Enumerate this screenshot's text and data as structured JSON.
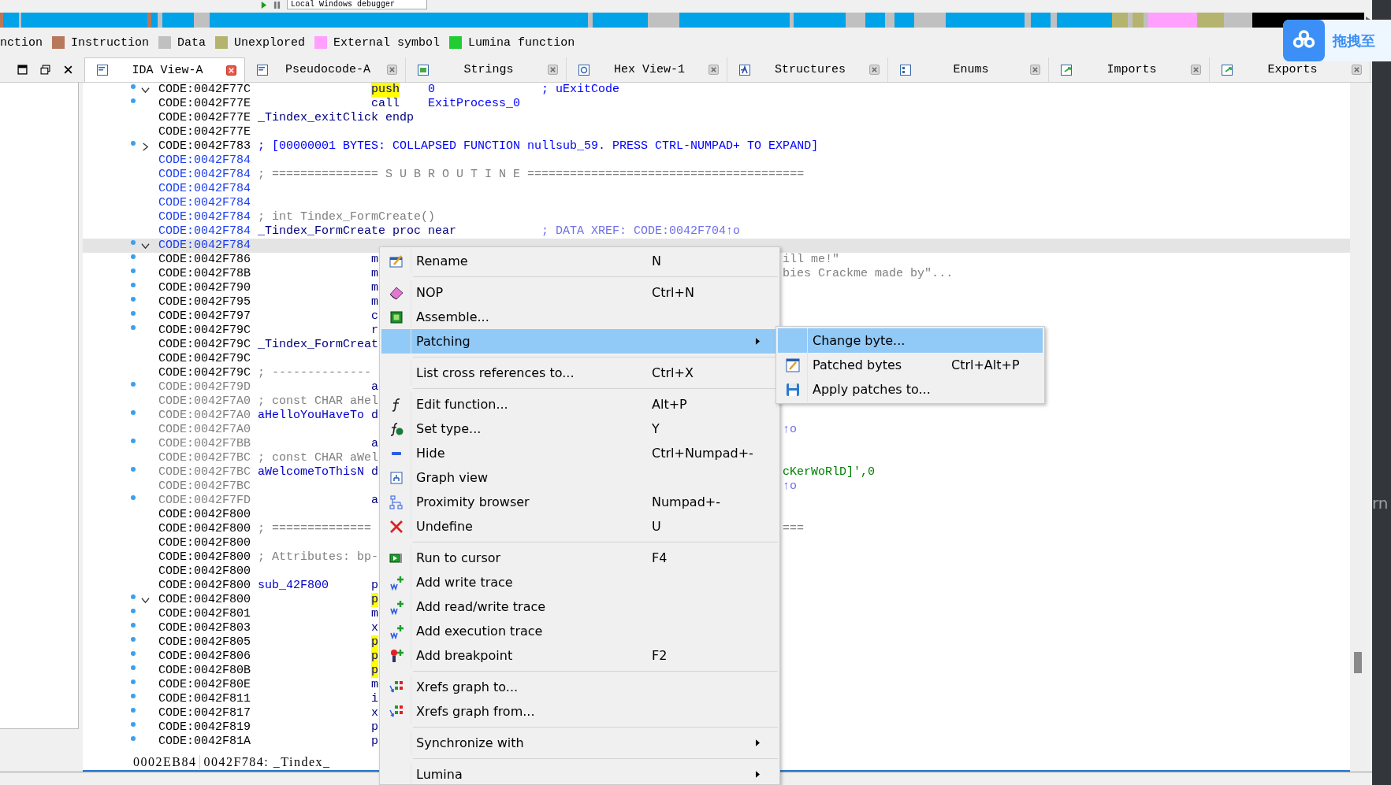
{
  "toolbar": {
    "debugger": "Local Windows debugger"
  },
  "legend": [
    {
      "label": "nction"
    },
    {
      "label": "Instruction",
      "color": "#b8785a"
    },
    {
      "label": "Data",
      "color": "#c0c0c0"
    },
    {
      "label": "Unexplored",
      "color": "#b4b46e"
    },
    {
      "label": "External symbol",
      "color": "#ffa0ff"
    },
    {
      "label": "Lumina function",
      "color": "#22cc33"
    }
  ],
  "tabs": [
    {
      "label": "IDA View-A",
      "selected": true
    },
    {
      "label": "Pseudocode-A",
      "selected": false
    },
    {
      "label": "Strings",
      "selected": false
    },
    {
      "label": "Hex View-1",
      "selected": false
    },
    {
      "label": "Structures",
      "selected": false
    },
    {
      "label": "Enums",
      "selected": false
    },
    {
      "label": "Imports",
      "selected": false
    },
    {
      "label": "Exports",
      "selected": false
    }
  ],
  "rows": [
    {
      "marker": true,
      "expanded": true,
      "address": "CODE:0042F77C",
      "kind": "code",
      "mnemonic": {
        "text": "push",
        "highlighted": true
      },
      "operand": "0",
      "comment": {
        "text": "; uExitCode",
        "kind": "note"
      },
      "selected": false
    },
    {
      "marker": true,
      "address": "CODE:0042F77E",
      "kind": "code",
      "mnemonic": {
        "text": "call",
        "highlighted": false
      },
      "operand": "ExitProcess_0",
      "selected": false
    },
    {
      "marker": false,
      "address": "CODE:0042F77E",
      "kind": "code",
      "label": {
        "text": "_Tindex_exitClick endp",
        "kind": "name"
      },
      "selected": false
    },
    {
      "marker": false,
      "address": "CODE:0042F77E",
      "kind": "code",
      "selected": false
    },
    {
      "marker": true,
      "expanded": false,
      "address": "CODE:0042F783",
      "kind": "code",
      "label": {
        "text": "; [00000001 BYTES: COLLAPSED FUNCTION nullsub_59. PRESS CTRL-NUMPAD+ TO EXPAND]",
        "kind": "collapsed"
      },
      "selected": false
    },
    {
      "marker": false,
      "address": "CODE:0042F784",
      "kind": "func",
      "selected": false
    },
    {
      "marker": false,
      "address": "CODE:0042F784",
      "kind": "func",
      "label": {
        "text": "; =============== S U B R O U T I N E =======================================",
        "kind": "comment"
      },
      "selected": false
    },
    {
      "marker": false,
      "address": "CODE:0042F784",
      "kind": "func",
      "selected": false
    },
    {
      "marker": false,
      "address": "CODE:0042F784",
      "kind": "func",
      "selected": false
    },
    {
      "marker": false,
      "address": "CODE:0042F784",
      "kind": "func",
      "label": {
        "text": "; int Tindex_FormCreate()",
        "kind": "comment"
      },
      "selected": false
    },
    {
      "marker": false,
      "address": "CODE:0042F784",
      "kind": "func",
      "label": {
        "text": "_Tindex_FormCreate proc near",
        "kind": "name"
      },
      "comment": {
        "text": "; DATA XREF: CODE:0042F704↑o",
        "kind": "xref"
      },
      "selected": false
    },
    {
      "marker": true,
      "expanded": true,
      "address": "CODE:0042F784",
      "kind": "func",
      "selected": true
    },
    {
      "marker": true,
      "address": "CODE:0042F786",
      "kind": "code",
      "mnemonic": {
        "text": "m",
        "highlighted": false
      },
      "tail": {
        "text": "ill me!\"",
        "kind": "comment"
      },
      "selected": false
    },
    {
      "marker": true,
      "address": "CODE:0042F78B",
      "kind": "code",
      "mnemonic": {
        "text": "m",
        "highlighted": false
      },
      "tail": {
        "text": "bies Crackme made by\"...",
        "kind": "comment"
      },
      "selected": false
    },
    {
      "marker": true,
      "address": "CODE:0042F790",
      "kind": "code",
      "mnemonic": {
        "text": "m",
        "highlighted": false
      },
      "selected": false
    },
    {
      "marker": true,
      "address": "CODE:0042F795",
      "kind": "code",
      "mnemonic": {
        "text": "m",
        "highlighted": false
      },
      "selected": false
    },
    {
      "marker": true,
      "address": "CODE:0042F797",
      "kind": "code",
      "mnemonic": {
        "text": "c",
        "highlighted": false
      },
      "selected": false
    },
    {
      "marker": true,
      "address": "CODE:0042F79C",
      "kind": "code",
      "mnemonic": {
        "text": "r",
        "highlighted": false
      },
      "selected": false
    },
    {
      "marker": false,
      "address": "CODE:0042F79C",
      "kind": "code",
      "label": {
        "text": "_Tindex_FormCreat",
        "kind": "name"
      },
      "selected": false
    },
    {
      "marker": false,
      "address": "CODE:0042F79C",
      "kind": "code",
      "selected": false
    },
    {
      "marker": false,
      "address": "CODE:0042F79C",
      "kind": "code",
      "label": {
        "text": "; --------------",
        "kind": "comment"
      },
      "selected": false
    },
    {
      "marker": true,
      "address": "CODE:0042F79D",
      "kind": "data",
      "mnemonic": {
        "text": "a",
        "highlighted": false
      },
      "selected": false
    },
    {
      "marker": false,
      "address": "CODE:0042F7A0",
      "kind": "data",
      "label": {
        "text": "; const CHAR aHel",
        "kind": "comment"
      },
      "selected": false
    },
    {
      "marker": true,
      "address": "CODE:0042F7A0",
      "kind": "data",
      "label": {
        "text": "aHelloYouHaveTo",
        "kind": "data"
      },
      "mnemonic": {
        "text": "d",
        "highlighted": false
      },
      "selected": false
    },
    {
      "marker": false,
      "address": "CODE:0042F7A0",
      "kind": "data",
      "tail": {
        "text": "↑o",
        "kind": "xref"
      },
      "selected": false
    },
    {
      "marker": true,
      "address": "CODE:0042F7BB",
      "kind": "data",
      "mnemonic": {
        "text": "a",
        "highlighted": false
      },
      "selected": false
    },
    {
      "marker": false,
      "address": "CODE:0042F7BC",
      "kind": "data",
      "label": {
        "text": "; const CHAR aWel",
        "kind": "comment"
      },
      "selected": false
    },
    {
      "marker": true,
      "address": "CODE:0042F7BC",
      "kind": "data",
      "label": {
        "text": "aWelcomeToThisN",
        "kind": "data"
      },
      "mnemonic": {
        "text": "d",
        "highlighted": false
      },
      "tail": {
        "text": "cKerWoRlD]',0",
        "kind": "string"
      },
      "selected": false
    },
    {
      "marker": false,
      "address": "CODE:0042F7BC",
      "kind": "data",
      "tail": {
        "text": "↑o",
        "kind": "xref"
      },
      "selected": false
    },
    {
      "marker": true,
      "address": "CODE:0042F7FD",
      "kind": "data",
      "mnemonic": {
        "text": "a",
        "highlighted": false
      },
      "selected": false
    },
    {
      "marker": false,
      "address": "CODE:0042F800",
      "kind": "code",
      "selected": false
    },
    {
      "marker": false,
      "address": "CODE:0042F800",
      "kind": "code",
      "label": {
        "text": "; ==============",
        "kind": "comment"
      },
      "tail": {
        "text": "===",
        "kind": "comment"
      },
      "selected": false
    },
    {
      "marker": false,
      "address": "CODE:0042F800",
      "kind": "code",
      "selected": false
    },
    {
      "marker": false,
      "address": "CODE:0042F800",
      "kind": "code",
      "label": {
        "text": "; Attributes: bp-",
        "kind": "comment"
      },
      "selected": false
    },
    {
      "marker": false,
      "address": "CODE:0042F800",
      "kind": "code",
      "selected": false
    },
    {
      "marker": false,
      "address": "CODE:0042F800",
      "kind": "code",
      "label": {
        "text": "sub_42F800",
        "kind": "data"
      },
      "mnemonic": {
        "text": "p",
        "highlighted": false
      },
      "selected": false
    },
    {
      "marker": true,
      "expanded": true,
      "address": "CODE:0042F800",
      "kind": "code",
      "mnemonic": {
        "text": "p",
        "highlighted": true
      },
      "selected": false
    },
    {
      "marker": true,
      "address": "CODE:0042F801",
      "kind": "code",
      "mnemonic": {
        "text": "m",
        "highlighted": false
      },
      "selected": false
    },
    {
      "marker": true,
      "address": "CODE:0042F803",
      "kind": "code",
      "mnemonic": {
        "text": "x",
        "highlighted": false
      },
      "selected": false
    },
    {
      "marker": true,
      "address": "CODE:0042F805",
      "kind": "code",
      "mnemonic": {
        "text": "p",
        "highlighted": true
      },
      "selected": false
    },
    {
      "marker": true,
      "address": "CODE:0042F806",
      "kind": "code",
      "mnemonic": {
        "text": "p",
        "highlighted": true
      },
      "selected": false
    },
    {
      "marker": true,
      "address": "CODE:0042F80B",
      "kind": "code",
      "mnemonic": {
        "text": "p",
        "highlighted": true
      },
      "selected": false
    },
    {
      "marker": true,
      "address": "CODE:0042F80E",
      "kind": "code",
      "mnemonic": {
        "text": "m",
        "highlighted": false
      },
      "selected": false
    },
    {
      "marker": true,
      "address": "CODE:0042F811",
      "kind": "code",
      "mnemonic": {
        "text": "i",
        "highlighted": false
      },
      "selected": false
    },
    {
      "marker": true,
      "address": "CODE:0042F817",
      "kind": "code",
      "mnemonic": {
        "text": "x",
        "highlighted": false
      },
      "selected": false
    },
    {
      "marker": true,
      "address": "CODE:0042F819",
      "kind": "code",
      "mnemonic": {
        "text": "p",
        "highlighted": false
      },
      "selected": false
    },
    {
      "marker": true,
      "address": "CODE:0042F81A",
      "kind": "code",
      "mnemonic": {
        "text": "p",
        "highlighted": false
      },
      "selected": false
    }
  ],
  "status_bar": {
    "offset": "0002EB84",
    "location": "0042F784: _Tindex_"
  },
  "menu": {
    "items": [
      {
        "kind": "rename",
        "label": "Rename",
        "shortcut": "N",
        "submenu": false,
        "separator_before": false,
        "selected": false
      },
      {
        "kind": "eraser",
        "label": "NOP",
        "shortcut": "Ctrl+N",
        "submenu": false,
        "separator_before": true,
        "selected": false
      },
      {
        "kind": "chip",
        "label": "Assemble...",
        "submenu": false,
        "separator_before": false,
        "selected": false
      },
      {
        "kind": "plain",
        "label": "Patching",
        "submenu": true,
        "separator_before": false,
        "selected": true
      },
      {
        "kind": "plain",
        "label": "List cross references to...",
        "shortcut": "Ctrl+X",
        "submenu": false,
        "separator_before": true,
        "selected": false
      },
      {
        "kind": "function",
        "label": "Edit function...",
        "shortcut": "Alt+P",
        "submenu": false,
        "separator_before": true,
        "selected": false
      },
      {
        "kind": "type",
        "label": "Set type...",
        "shortcut": "Y",
        "submenu": false,
        "separator_before": false,
        "selected": false
      },
      {
        "kind": "minus",
        "label": "Hide",
        "shortcut": "Ctrl+Numpad+-",
        "submenu": false,
        "separator_before": false,
        "selected": false
      },
      {
        "kind": "graph",
        "label": "Graph view",
        "submenu": false,
        "separator_before": false,
        "selected": false
      },
      {
        "kind": "tree",
        "label": "Proximity browser",
        "shortcut": "Numpad+-",
        "submenu": false,
        "separator_before": false,
        "selected": false
      },
      {
        "kind": "cross",
        "label": "Undefine",
        "shortcut": "U",
        "submenu": false,
        "separator_before": false,
        "selected": false
      },
      {
        "kind": "run",
        "label": "Run to cursor",
        "shortcut": "F4",
        "submenu": false,
        "separator_before": true,
        "selected": false
      },
      {
        "kind": "trace",
        "label": "Add write trace",
        "submenu": false,
        "separator_before": false,
        "selected": false
      },
      {
        "kind": "trace",
        "label": "Add read/write trace",
        "submenu": false,
        "separator_before": false,
        "selected": false
      },
      {
        "kind": "trace",
        "label": "Add execution trace",
        "submenu": false,
        "separator_before": false,
        "selected": false
      },
      {
        "kind": "breakpoint",
        "label": "Add breakpoint",
        "shortcut": "F2",
        "submenu": false,
        "separator_before": false,
        "selected": false
      },
      {
        "kind": "xrefs",
        "label": "Xrefs graph to...",
        "submenu": false,
        "separator_before": true,
        "selected": false
      },
      {
        "kind": "xrefs",
        "label": "Xrefs graph from...",
        "submenu": false,
        "separator_before": false,
        "selected": false
      },
      {
        "kind": "plain",
        "label": "Synchronize with",
        "submenu": true,
        "separator_before": true,
        "selected": false
      },
      {
        "kind": "plain",
        "label": "Lumina",
        "submenu": true,
        "separator_before": true,
        "selected": false
      }
    ],
    "submenu": [
      {
        "kind": "plain",
        "label": "Change byte...",
        "selected": true
      },
      {
        "kind": "rename",
        "label": "Patched bytes",
        "shortcut": "Ctrl+Alt+P",
        "selected": false
      },
      {
        "kind": "floppy",
        "label": "Apply patches to...",
        "selected": false
      }
    ]
  },
  "overlay": {
    "label": "拖拽至"
  },
  "side_text": "rn"
}
